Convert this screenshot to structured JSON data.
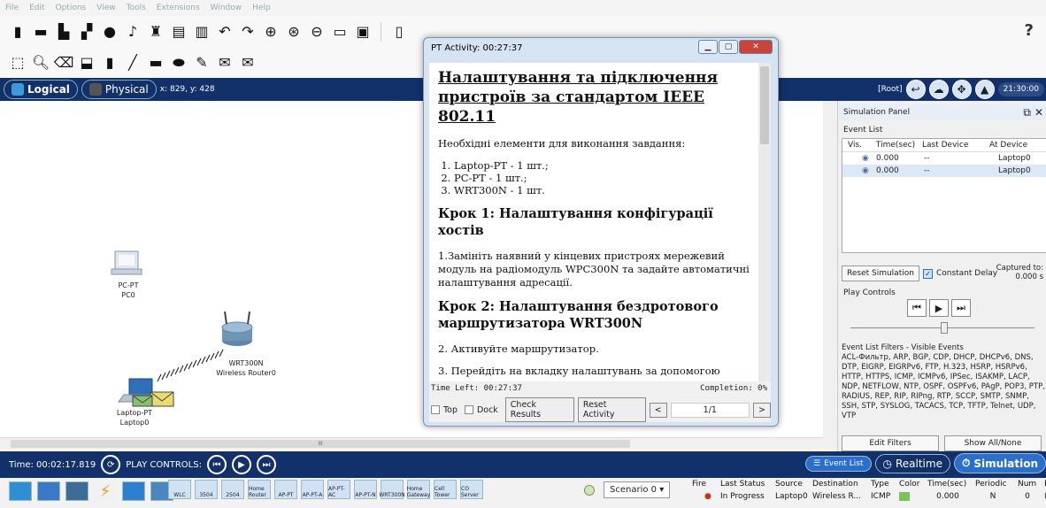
{
  "menu": [
    "File",
    "Edit",
    "Options",
    "View",
    "Tools",
    "Extensions",
    "Window",
    "Help"
  ],
  "help_symbol": "?",
  "workspace": {
    "logical": "Logical",
    "physical": "Physical",
    "coords": "x: 829, y: 428",
    "root": "[Root]",
    "clock": "21:30:00"
  },
  "devices": {
    "pc": {
      "type": "PC-PT",
      "name": "PC0"
    },
    "router": {
      "type": "WRT300N",
      "name": "Wireless Router0"
    },
    "laptop": {
      "type": "Laptop-PT",
      "name": "Laptop0"
    }
  },
  "scroll_arrow": "III",
  "timebar": {
    "time": "Time: 00:02:17.819",
    "label": "PLAY CONTROLS:"
  },
  "modes": {
    "event_list": "Event List",
    "realtime": "Realtime",
    "simulation": "Simulation"
  },
  "device_palette": [
    "WLC",
    "3504",
    "2504",
    "Home Router",
    "AP-PT",
    "AP-PT-A",
    "AP-PT-AC",
    "AP-PT-N",
    "WRT300N",
    "Home Gateway",
    "Cell Tower",
    "CO Server"
  ],
  "scenario": {
    "label": "Scenario 0",
    "arrow": "▾"
  },
  "event_table": {
    "headers": [
      "Fire",
      "Last Status",
      "Source",
      "Destination",
      "Type",
      "Color",
      "Time(sec)",
      "Periodic",
      "Num",
      "Ed"
    ],
    "row": [
      "",
      "In Progress",
      "Laptop0",
      "Wireless R...",
      "ICMP",
      "",
      "0.000",
      "N",
      "0",
      "(e"
    ]
  },
  "pt_window": {
    "title": "PT Activity: 00:27:37",
    "heading": "Налаштування та підключення пристроїв за стандартом IEEE 802.11",
    "intro": "Необхідні елементи для виконання завдання:",
    "items": [
      "Laptop-PT - 1 шт.;",
      "PC-PT - 1 шт.;",
      "WRT300N - 1 шт."
    ],
    "step1_title": "Крок 1: Налаштування конфігурації хостів",
    "step1_text": "1.Замініть наявний у кінцевих пристроях мережевий модуль на радіомодуль WPC300N та задайте автоматичні налаштування адресації.",
    "step2_title": "Крок 2: Налаштування бездротового маршрутизатора WRT300N",
    "step2_text1": "2. Активуйте маршрутизатор.",
    "step2_text2": "3. Перейдіть на вкладку налаштувань за допомогою",
    "time_left": "Time Left: 00:27:37",
    "completion": "Completion: 0%",
    "top": "Top",
    "dock": "Dock",
    "check_results": "Check Results",
    "reset_activity": "Reset Activity",
    "prev": "<",
    "page": "1/1",
    "next": ">"
  },
  "sim_panel": {
    "title": "Simulation Panel",
    "event_list": "Event List",
    "headers": [
      "Vis.",
      "Time(sec)",
      "Last Device",
      "At Device"
    ],
    "rows": [
      [
        "0.000",
        "--",
        "Laptop0"
      ],
      [
        "0.000",
        "--",
        "Laptop0"
      ]
    ],
    "reset": "Reset Simulation",
    "constant_delay": "Constant Delay",
    "captured": "Captured to:",
    "captured_val": "0.000 s",
    "play_controls": "Play Controls",
    "filters_title": "Event List Filters - Visible Events",
    "filters": "ACL-Фильтр, ARP, BGP, CDP, DHCP, DHCPv6, DNS, DTP, EIGRP, EIGRPv6, FTP, H.323, HSRP, HSRPv6, HTTP, HTTPS, ICMP, ICMPv6, IPSec, ISAKMP, LACP, NDP, NETFLOW, NTP, OSPF, OSPFv6, PAgP, POP3, PTP, RADIUS, REP, RIP, RIPng, RTP, SCCP, SMTP, SNMP, SSH, STP, SYSLOG, TACACS, TCP, TFTP, Telnet, UDP, VTP",
    "edit_filters": "Edit Filters",
    "show_all": "Show All/None"
  }
}
